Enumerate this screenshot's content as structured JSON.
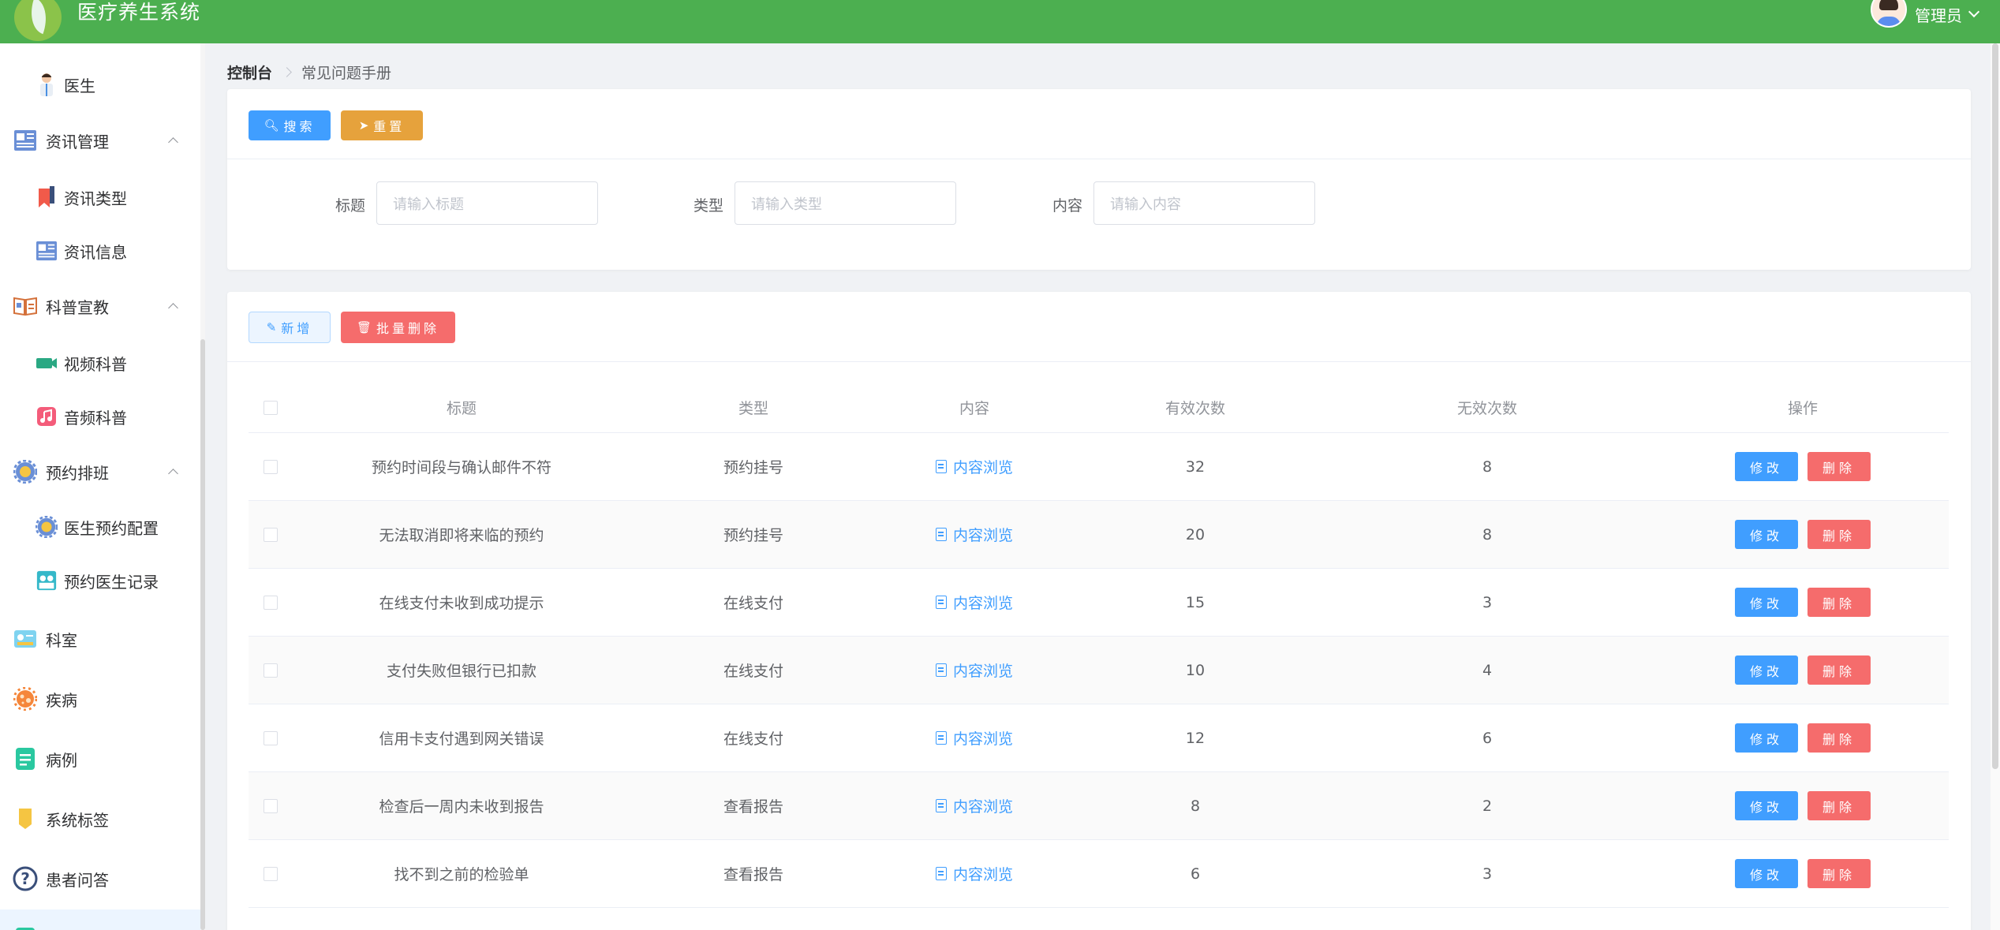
{
  "header": {
    "title": "医疗养生系统",
    "user": "管理员"
  },
  "sidebar": {
    "items": [
      {
        "label": "医生",
        "type": "sub"
      },
      {
        "label": "资讯管理",
        "type": "top"
      },
      {
        "label": "资讯类型",
        "type": "sub"
      },
      {
        "label": "资讯信息",
        "type": "sub"
      },
      {
        "label": "科普宣教",
        "type": "top"
      },
      {
        "label": "视频科普",
        "type": "sub"
      },
      {
        "label": "音频科普",
        "type": "sub"
      },
      {
        "label": "预约排班",
        "type": "top"
      },
      {
        "label": "医生预约配置",
        "type": "sub"
      },
      {
        "label": "预约医生记录",
        "type": "sub"
      },
      {
        "label": "科室",
        "type": "top"
      },
      {
        "label": "疾病",
        "type": "top"
      },
      {
        "label": "病例",
        "type": "top"
      },
      {
        "label": "系统标签",
        "type": "top"
      },
      {
        "label": "患者问答",
        "type": "top"
      }
    ]
  },
  "breadcrumb": {
    "root": "控制台",
    "current": "常见问题手册"
  },
  "search": {
    "search_label": "搜索",
    "reset_label": "重置",
    "fields": [
      {
        "label": "标题",
        "placeholder": "请输入标题"
      },
      {
        "label": "类型",
        "placeholder": "请输入类型"
      },
      {
        "label": "内容",
        "placeholder": "请输入内容"
      }
    ]
  },
  "actions": {
    "add_label": "新增",
    "batch_delete_label": "批量删除"
  },
  "table": {
    "columns": [
      "标题",
      "类型",
      "内容",
      "有效次数",
      "无效次数",
      "操作"
    ],
    "content_link": "内容浏览",
    "edit_label": "修改",
    "delete_label": "删除",
    "rows": [
      {
        "title": "预约时间段与确认邮件不符",
        "type": "预约挂号",
        "valid": "32",
        "invalid": "8"
      },
      {
        "title": "无法取消即将来临的预约",
        "type": "预约挂号",
        "valid": "20",
        "invalid": "8"
      },
      {
        "title": "在线支付未收到成功提示",
        "type": "在线支付",
        "valid": "15",
        "invalid": "3"
      },
      {
        "title": "支付失败但银行已扣款",
        "type": "在线支付",
        "valid": "10",
        "invalid": "4"
      },
      {
        "title": "信用卡支付遇到网关错误",
        "type": "在线支付",
        "valid": "12",
        "invalid": "6"
      },
      {
        "title": "检查后一周内未收到报告",
        "type": "查看报告",
        "valid": "8",
        "invalid": "2"
      },
      {
        "title": "找不到之前的检验单",
        "type": "查看报告",
        "valid": "6",
        "invalid": "3"
      }
    ]
  },
  "colors": {
    "header": "#4caf50",
    "primary": "#409eff",
    "warning": "#e6a23c",
    "danger": "#f56c6c"
  }
}
